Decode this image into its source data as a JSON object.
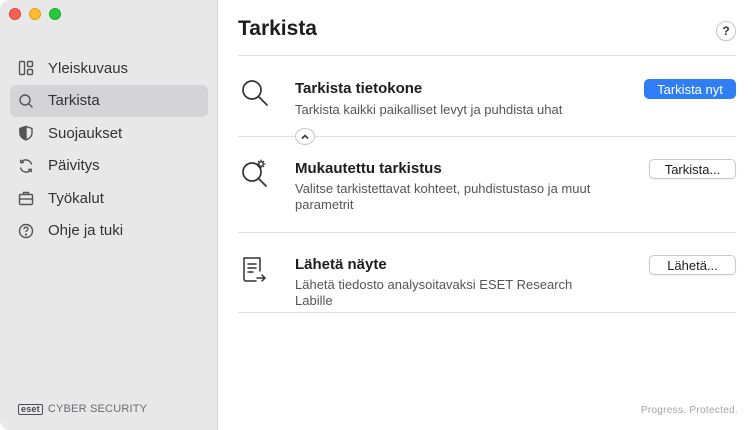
{
  "sidebar": {
    "items": [
      {
        "label": "Yleiskuvaus",
        "icon": "dashboard-icon"
      },
      {
        "label": "Tarkista",
        "icon": "search-icon",
        "active": true
      },
      {
        "label": "Suojaukset",
        "icon": "shield-icon"
      },
      {
        "label": "Päivitys",
        "icon": "refresh-icon"
      },
      {
        "label": "Työkalut",
        "icon": "briefcase-icon"
      },
      {
        "label": "Ohje ja tuki",
        "icon": "help-circle-icon"
      }
    ],
    "brand_logo": "eset",
    "brand_text": "CYBER SECURITY"
  },
  "main": {
    "title": "Tarkista",
    "help_label": "?",
    "rows": [
      {
        "title": "Tarkista tietokone",
        "description": "Tarkista kaikki paikalliset levyt ja puhdista uhat",
        "button": "Tarkista nyt",
        "icon": "magnifier-icon"
      },
      {
        "title": "Mukautettu tarkistus",
        "description": "Valitse tarkistettavat kohteet, puhdistustaso ja muut parametrit",
        "button": "Tarkista...",
        "icon": "magnifier-gear-icon"
      },
      {
        "title": "Lähetä näyte",
        "description": "Lähetä tiedosto analysoitavaksi ESET Research Labille",
        "button": "Lähetä...",
        "icon": "document-send-icon"
      }
    ],
    "tagline": "Progress. Protected."
  },
  "colors": {
    "accent": "#2f7ef5",
    "sidebar_bg": "#e8e8e9",
    "active_item_bg": "#d4d4d6"
  }
}
